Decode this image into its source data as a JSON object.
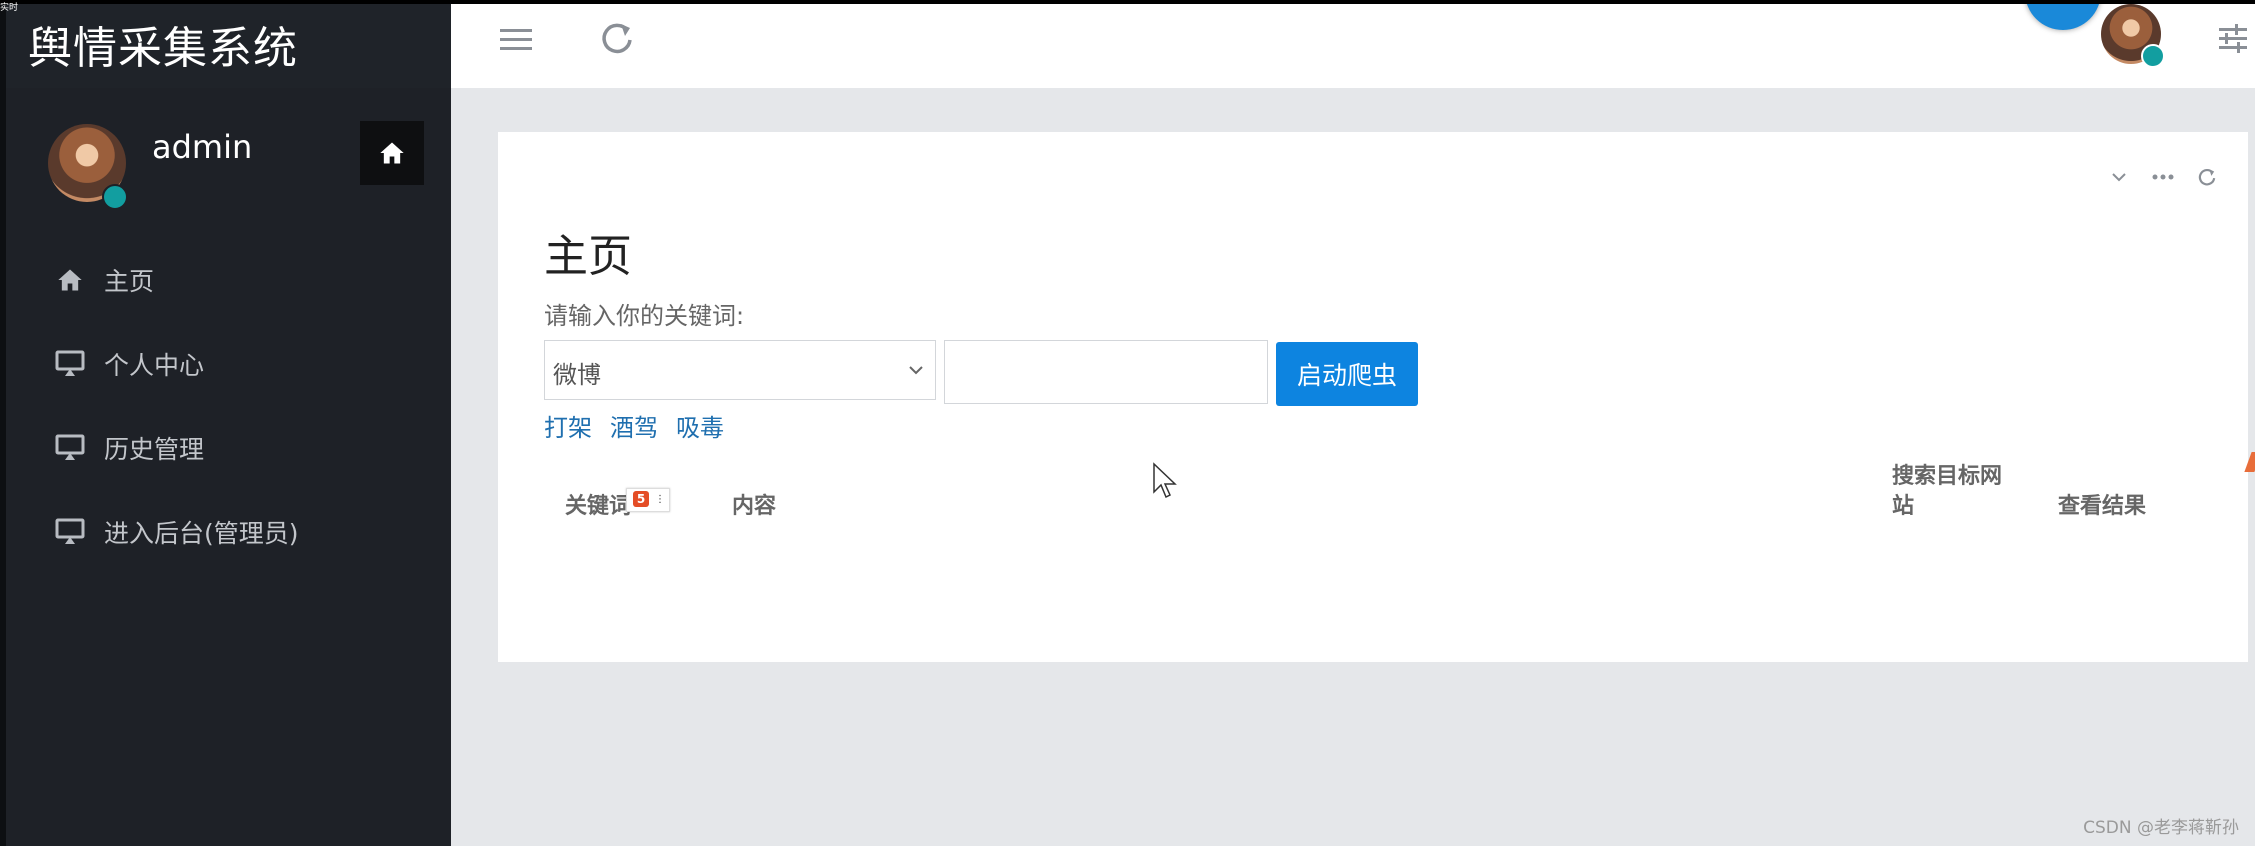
{
  "app": {
    "title": "舆情采集系统",
    "corner_text": "实时"
  },
  "sidebar": {
    "user_name": "admin",
    "items": [
      {
        "label": "主页",
        "icon": "home-icon"
      },
      {
        "label": "个人中心",
        "icon": "monitor-icon"
      },
      {
        "label": "历史管理",
        "icon": "monitor-icon"
      },
      {
        "label": "进入后台(管理员)",
        "icon": "monitor-icon"
      }
    ]
  },
  "main": {
    "page_title": "主页",
    "keyword_prompt": "请输入你的关键词:",
    "platform_select": {
      "value": "微博"
    },
    "keyword_input": {
      "value": "",
      "placeholder": ""
    },
    "start_button": "启动爬虫",
    "quick_keywords": [
      "打架",
      "酒驾",
      "吸毒"
    ],
    "table": {
      "headers": [
        "关键词",
        "内容",
        "搜索目标网站",
        "查看结果"
      ],
      "rows": []
    }
  },
  "watermark": "CSDN @老李蒋靳孙",
  "colors": {
    "sidebar_bg": "#1e2127",
    "accent_button": "#0d84e0",
    "status_online": "#129ea0",
    "link": "#1f6faf"
  }
}
